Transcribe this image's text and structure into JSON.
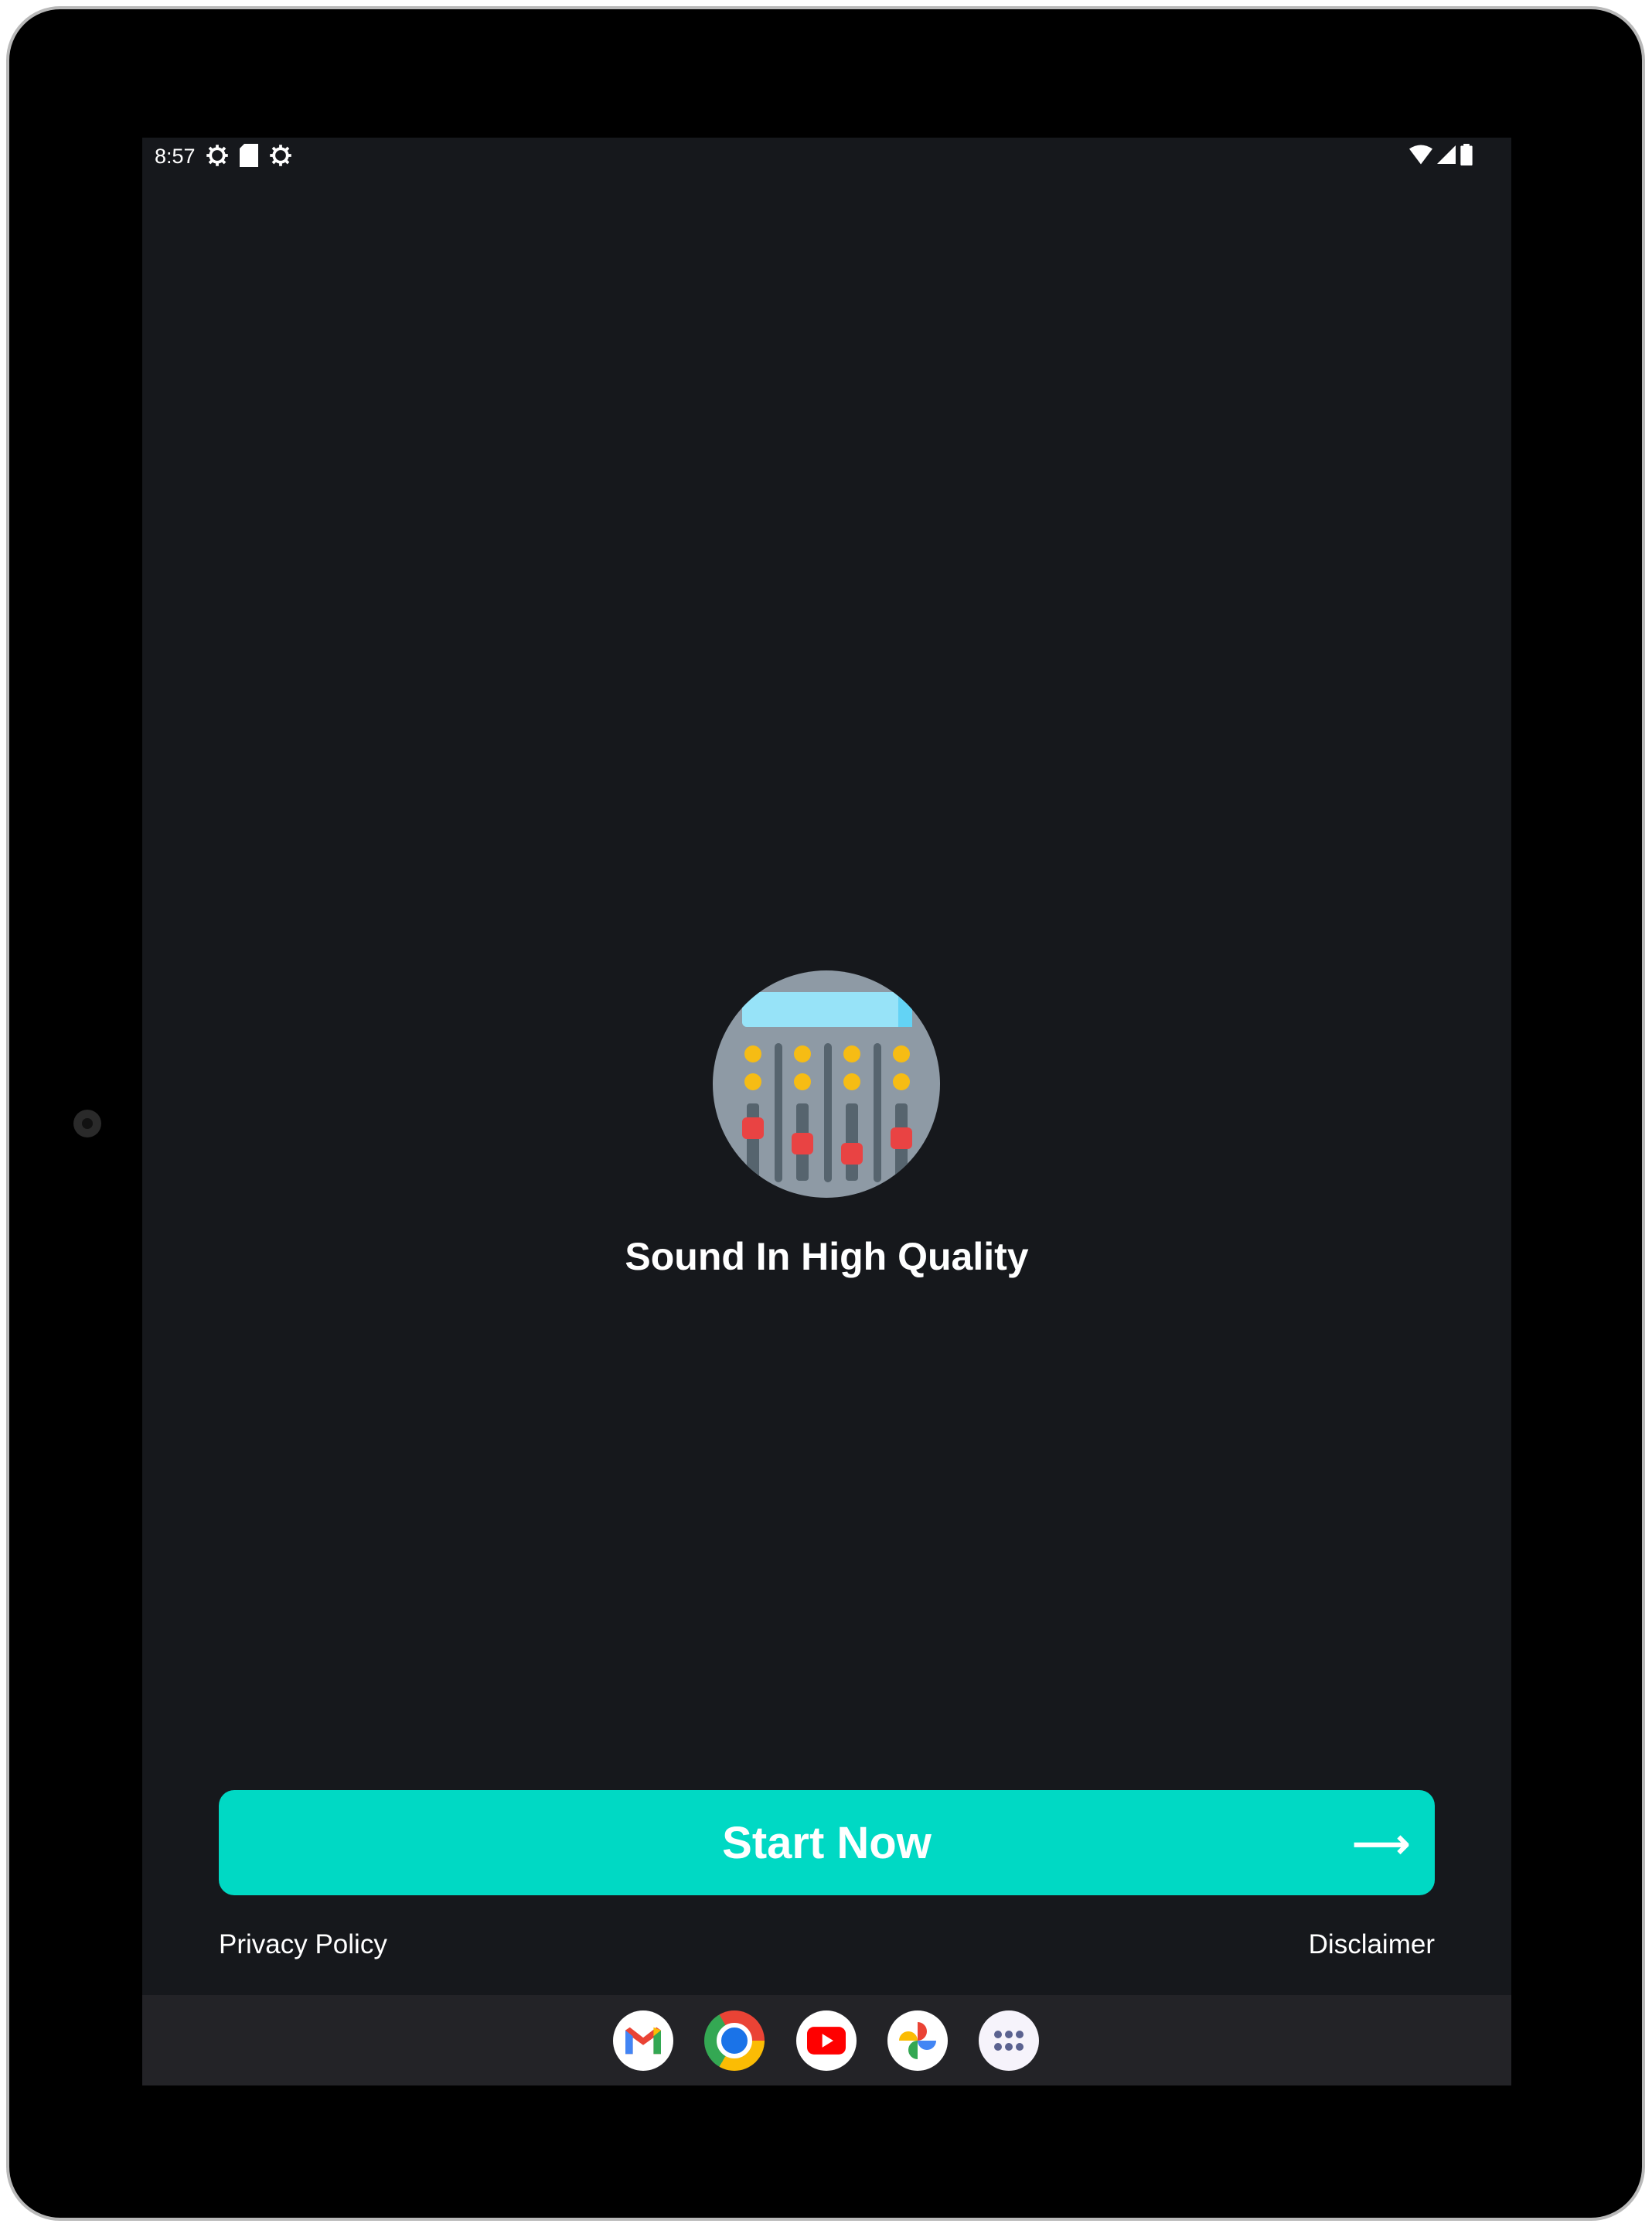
{
  "status_bar": {
    "time": "8:57",
    "left_icons": [
      "settings-icon",
      "sd-card-icon",
      "settings-icon"
    ],
    "right_icons": [
      "wifi-icon",
      "signal-icon",
      "battery-icon"
    ]
  },
  "main": {
    "logo_icon": "audio-mixer-icon",
    "title": "Sound In High Quality",
    "start_button": {
      "label": "Start Now",
      "icon": "arrow-right-icon",
      "color": "#00d9c4"
    },
    "privacy_link": "Privacy Policy",
    "disclaimer_link": "Disclaimer"
  },
  "dock": {
    "apps": [
      "Gmail",
      "Chrome",
      "YouTube",
      "Photos",
      "App drawer"
    ]
  }
}
